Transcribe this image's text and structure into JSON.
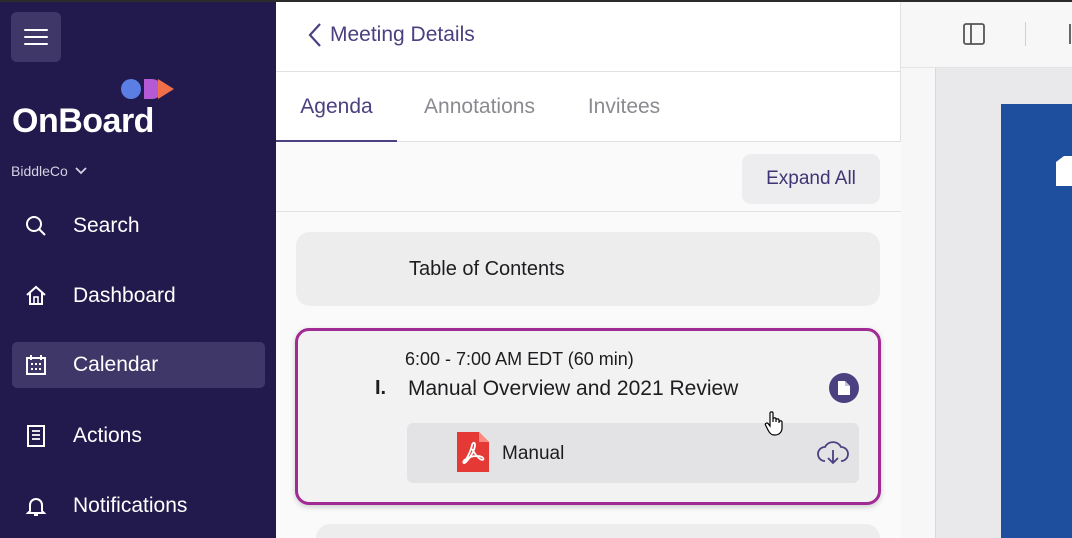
{
  "sidebar": {
    "menu_icon": "hamburger-icon",
    "logo_text": "OnBoard",
    "org_name": "BiddleCo",
    "nav": [
      {
        "label": "Search",
        "icon": "search-icon"
      },
      {
        "label": "Dashboard",
        "icon": "home-icon"
      },
      {
        "label": "Calendar",
        "icon": "calendar-icon",
        "active": true
      },
      {
        "label": "Actions",
        "icon": "list-icon"
      },
      {
        "label": "Notifications",
        "icon": "bell-icon"
      }
    ]
  },
  "header": {
    "back_label": "Meeting Details"
  },
  "tabs": [
    {
      "label": "Agenda",
      "active": true
    },
    {
      "label": "Annotations",
      "active": false
    },
    {
      "label": "Invitees",
      "active": false
    }
  ],
  "toolbar": {
    "expand_all_label": "Expand All"
  },
  "agenda": {
    "toc_label": "Table of Contents",
    "item": {
      "time": "6:00 - 7:00 AM EDT (60 min)",
      "number": "I.",
      "title": "Manual Overview and 2021 Review",
      "attachment": {
        "label": "Manual",
        "type_icon": "pdf-icon",
        "action_icon": "cloud-download-icon"
      }
    }
  },
  "colors": {
    "sidebar_bg": "#221a4d",
    "accent": "#4b4080",
    "selected_border": "#a12b95",
    "pdf_red": "#e53935",
    "document_blue": "#1d4f9e"
  }
}
